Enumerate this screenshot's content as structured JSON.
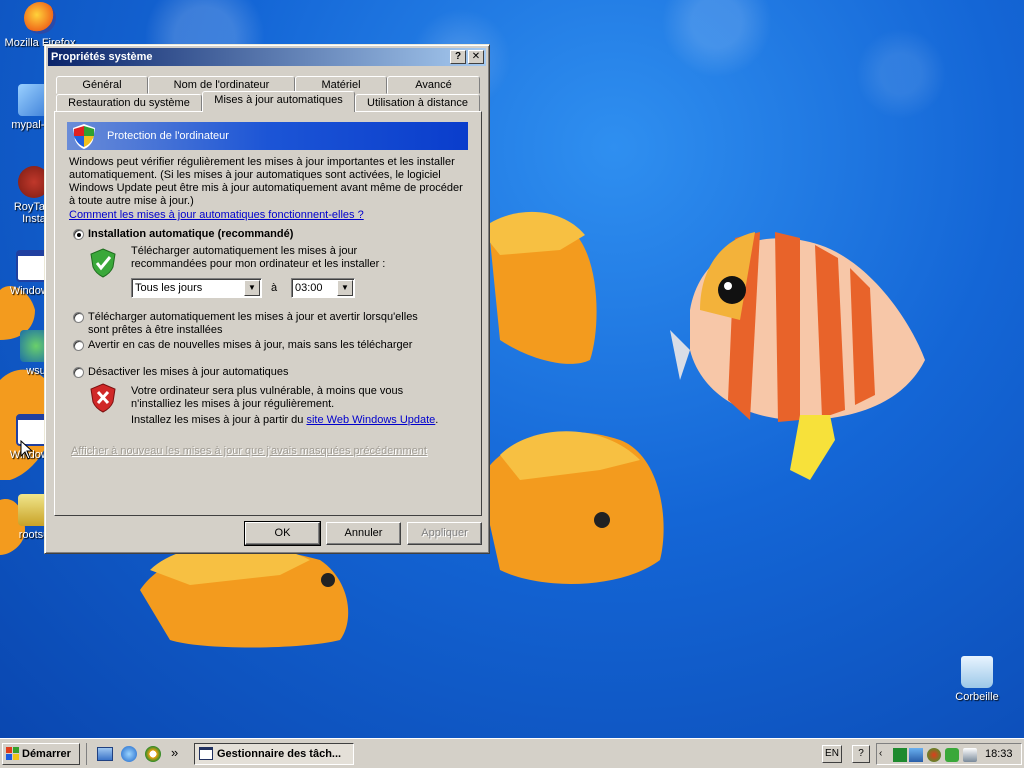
{
  "desktop": {
    "icons": [
      {
        "label": "Mozilla Firefox"
      },
      {
        "label": "mypal-29"
      },
      {
        "label": "RoyTam Insta"
      },
      {
        "label": "Windows"
      },
      {
        "label": "wsu"
      },
      {
        "label": "Windows"
      },
      {
        "label": "rootsu"
      },
      {
        "label": "Corbeille"
      }
    ]
  },
  "dialog": {
    "title": "Propriétés système",
    "help_btn": "?",
    "close_btn": "✕",
    "tabs_row1": [
      "Général",
      "Nom de l'ordinateur",
      "Matériel",
      "Avancé"
    ],
    "tabs_row2": [
      "Restauration du système",
      "Mises à jour automatiques",
      "Utilisation à distance"
    ],
    "banner_title": "Protection de l'ordinateur",
    "intro": "Windows peut vérifier régulièrement les mises à jour importantes et les installer automatiquement. (Si les mises à jour automatiques sont activées, le logiciel Windows Update peut être mis à jour automatiquement avant même de procéder à toute autre mise à jour.)",
    "how_link": "Comment les mises à jour automatiques fonctionnent-elles ?",
    "options": {
      "auto_label": "Installation automatique (recommandé)",
      "auto_desc": "Télécharger automatiquement les mises à jour recommandées pour mon ordinateur et les installer :",
      "day_value": "Tous les jours",
      "at_label": "à",
      "time_value": "03:00",
      "download_label": "Télécharger automatiquement les mises à jour et avertir lorsqu'elles sont prêtes à être installées",
      "notify_label": "Avertir en cas de nouvelles mises à jour, mais sans les télécharger",
      "disable_label": "Désactiver les mises à jour automatiques",
      "disable_desc": "Votre ordinateur sera plus vulnérable, à moins que vous n'installiez les mises à jour régulièrement.",
      "install_from": "Installez les mises à jour à partir du",
      "site_link": "site Web Windows Update",
      "period": "."
    },
    "hidden_link": "Afficher à nouveau les mises à jour que j'avais masquées précédemment",
    "ok": "OK",
    "cancel": "Annuler",
    "apply": "Appliquer"
  },
  "taskbar": {
    "start": "Démarrer",
    "chevron": "»",
    "task_label": "Gestionnaire des tâch...",
    "lang": "EN",
    "help": "?",
    "clock": "18:33"
  }
}
